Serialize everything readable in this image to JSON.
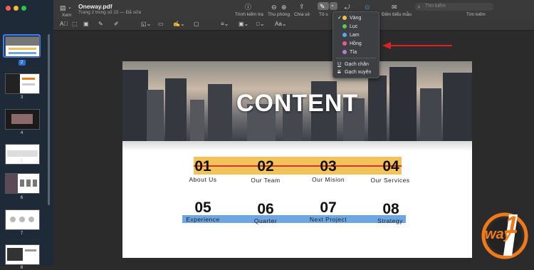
{
  "window": {
    "file_title": "Oneway.pdf",
    "subtitle": "Trang 2 trong số 15 — Đã sửa",
    "view_label": "Xem"
  },
  "toolbar": {
    "inspector_label": "Trình kiểm tra",
    "zoom_label": "Thu phóng",
    "share_label": "Chia sẻ",
    "highlight_label": "Tô s",
    "form_label": "Điền biểu mẫu",
    "search_placeholder": "Tìm kiếm",
    "search_label": "Tìm kiếm"
  },
  "format_bar": {
    "font_label": "Aa"
  },
  "sidebar": {
    "thumbnails": [
      {
        "num": "2",
        "selected": true
      },
      {
        "num": "3"
      },
      {
        "num": "4"
      },
      {
        "num": "5"
      },
      {
        "num": "6"
      },
      {
        "num": "7"
      },
      {
        "num": "8"
      }
    ]
  },
  "dropdown": {
    "colors": [
      {
        "label": "Vàng",
        "color": "#f5c33b",
        "checked": true
      },
      {
        "label": "Lục",
        "color": "#5fc85a"
      },
      {
        "label": "Lam",
        "color": "#5aa6f0"
      },
      {
        "label": "Hồng",
        "color": "#ee5d86"
      },
      {
        "label": "Tía",
        "color": "#b07ed6"
      }
    ],
    "underline_label": "Gạch chân",
    "strike_label": "Gạch xuyên",
    "check_mark": "✓"
  },
  "slide": {
    "title": "CONTENT",
    "row1": [
      {
        "num": "01",
        "label": "About Us"
      },
      {
        "num": "02",
        "label": "Our Team"
      },
      {
        "num": "03",
        "label": "Our Mision"
      },
      {
        "num": "04",
        "label": "Our Services"
      }
    ],
    "row2": [
      {
        "num": "05",
        "label": "Experience"
      },
      {
        "num": "06",
        "label": "Quarter"
      },
      {
        "num": "07",
        "label": "Next Project"
      },
      {
        "num": "08",
        "label": "Strategy"
      }
    ]
  },
  "logo": {
    "text": "way",
    "digit": "1",
    "colors": {
      "orange": "#f07a1a",
      "white": "#ffffff"
    }
  }
}
